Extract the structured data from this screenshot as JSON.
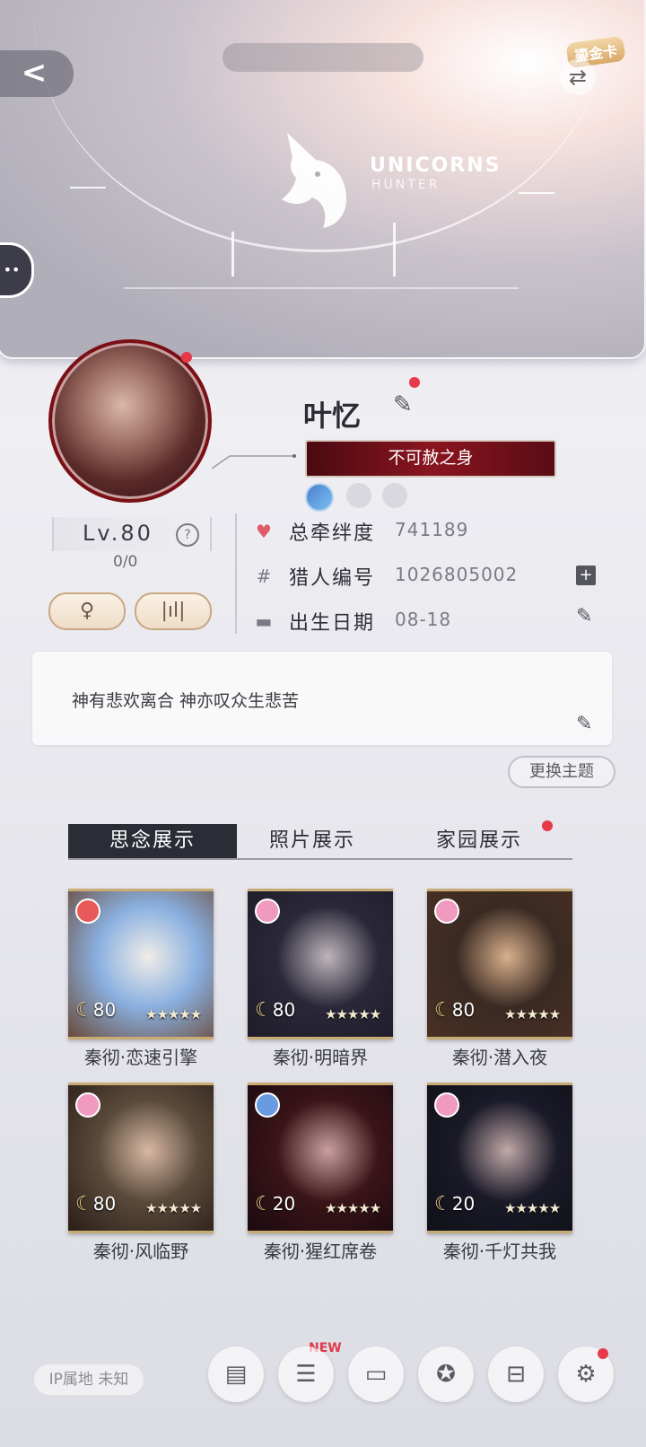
{
  "header": {
    "back_icon": "back-arrow-icon",
    "swap_icon": "swap-icon",
    "gold_card_label": "鎏金卡",
    "logo_text": "UNICORNS",
    "logo_sub": "HUNTER"
  },
  "profile": {
    "name": "叶忆",
    "title": "不可赦之身",
    "level": "Lv.80",
    "level_progress": "0/0",
    "stats": [
      {
        "label": "总牵绊度",
        "value": "741189",
        "icon": "heart-icon"
      },
      {
        "label": "猎人编号",
        "value": "1026805002",
        "icon": "hash-icon"
      },
      {
        "label": "出生日期",
        "value": "08-18",
        "icon": "briefcase-icon"
      }
    ],
    "signature": "神有悲欢离合 神亦叹众生悲苦",
    "change_theme": "更换主题"
  },
  "tabs": [
    "思念展示",
    "照片展示",
    "家园展示"
  ],
  "cards": [
    {
      "name": "秦彻·恋速引擎",
      "level": "80",
      "stars": "★★★★★",
      "badge_color": "#e85a5a",
      "bg": [
        "#8ab0e0",
        "#f0ede8",
        "#6a4a3a"
      ]
    },
    {
      "name": "秦彻·明暗界",
      "level": "80",
      "stars": "★★★★★",
      "badge_color": "#f09ac0",
      "bg": [
        "#2a2838",
        "#bfb6bc",
        "#1e1c28"
      ]
    },
    {
      "name": "秦彻·潜入夜",
      "level": "80",
      "stars": "★★★★★",
      "badge_color": "#f09ac0",
      "bg": [
        "#3a2a22",
        "#d8b08c",
        "#4a3024"
      ]
    },
    {
      "name": "秦彻·风临野",
      "level": "80",
      "stars": "★★★★★",
      "badge_color": "#f09ac0",
      "bg": [
        "#5a4a3a",
        "#d8b8a4",
        "#2a1e18"
      ]
    },
    {
      "name": "秦彻·猩红席卷",
      "level": "20",
      "stars": "★★★★★",
      "badge_color": "#6a9ae0",
      "bg": [
        "#3a1418",
        "#c8a0a0",
        "#1a0a10"
      ]
    },
    {
      "name": "秦彻·千灯共我",
      "level": "20",
      "stars": "★★★★★",
      "badge_color": "#f09ac0",
      "bg": [
        "#1a1a28",
        "#c0a8a8",
        "#101018"
      ]
    }
  ],
  "footer": {
    "ip_label": "IP属地 未知",
    "new_tag": "NEW",
    "nav": [
      "document-icon",
      "list-icon",
      "message-board-icon",
      "badge-icon",
      "bag-icon",
      "gear-icon"
    ]
  }
}
